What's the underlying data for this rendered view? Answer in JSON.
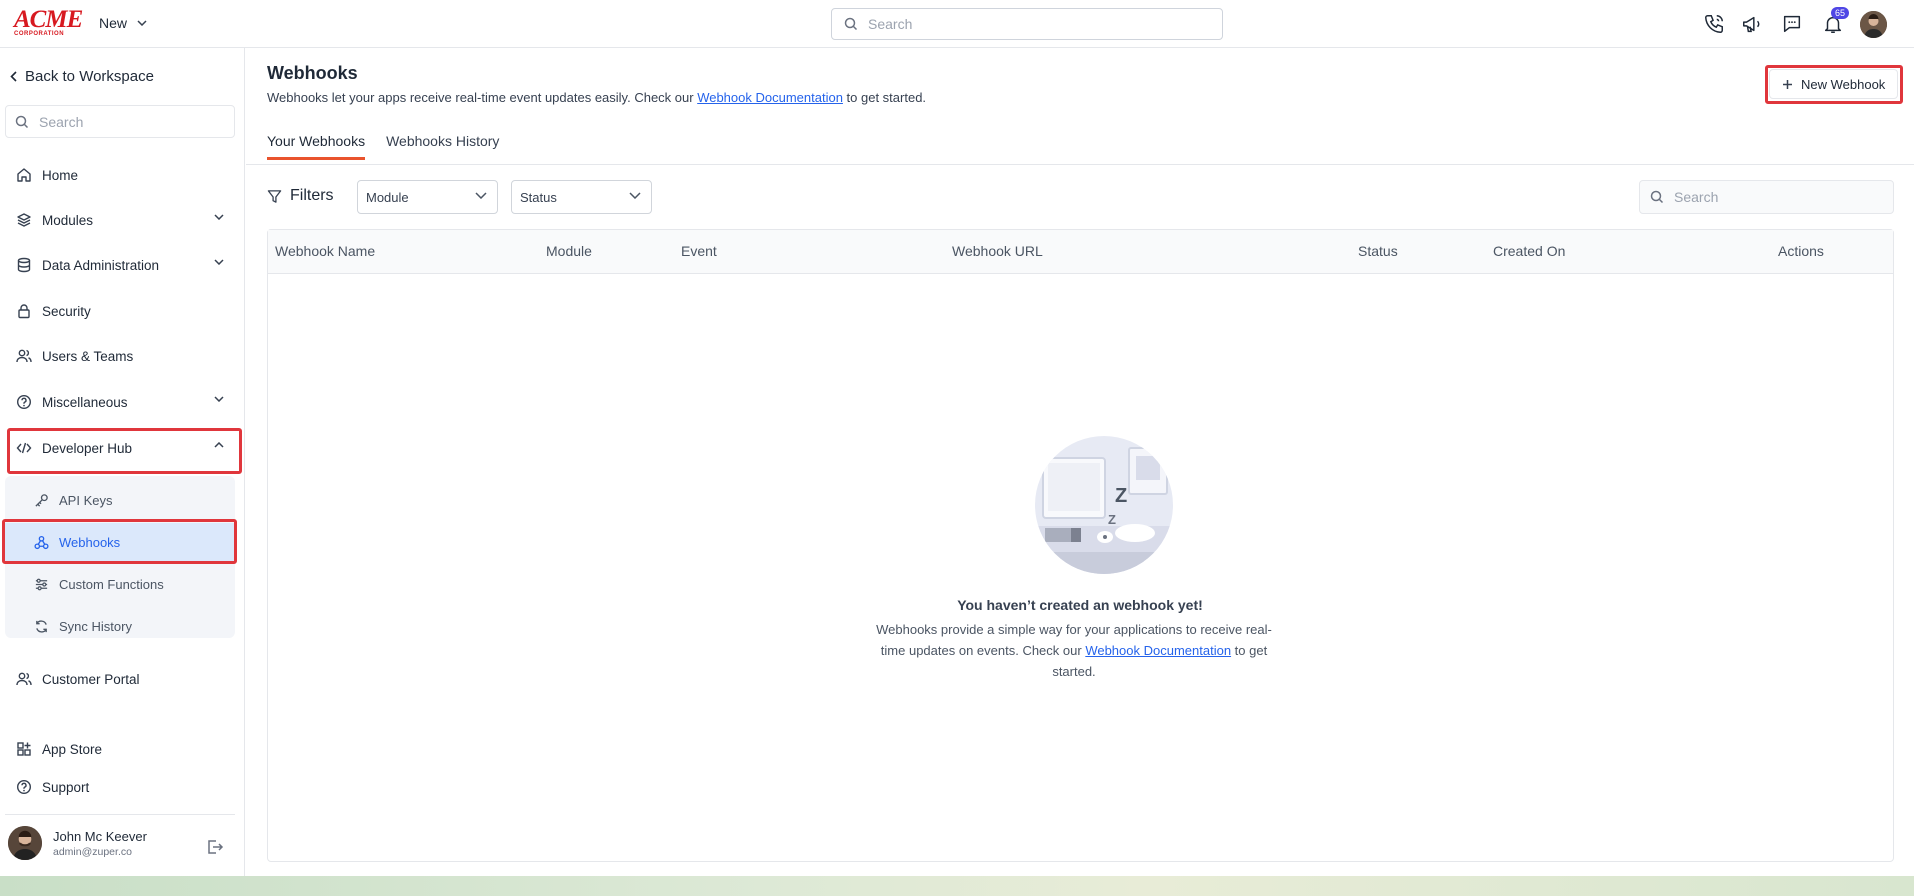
{
  "app": {
    "logo_word": "ACME",
    "logo_sub": "CORPORATION",
    "new_menu_label": "New",
    "search_placeholder": "Search",
    "notification_count": "65",
    "brand_color": "#d71920"
  },
  "sidebar": {
    "back_label": "Back to Workspace",
    "search_placeholder": "Search",
    "items": [
      {
        "label": "Home",
        "icon": "home-icon"
      },
      {
        "label": "Modules",
        "icon": "layers-icon",
        "expandable": true
      },
      {
        "label": "Data Administration",
        "icon": "database-icon",
        "expandable": true
      },
      {
        "label": "Security",
        "icon": "lock-icon"
      },
      {
        "label": "Users & Teams",
        "icon": "users-icon"
      },
      {
        "label": "Miscellaneous",
        "icon": "help-circle-icon",
        "expandable": true
      },
      {
        "label": "Developer Hub",
        "icon": "code-icon",
        "expanded": true
      }
    ],
    "developer_hub_items": [
      {
        "label": "API Keys",
        "icon": "key-icon"
      },
      {
        "label": "Webhooks",
        "icon": "webhook-icon",
        "active": true
      },
      {
        "label": "Custom Functions",
        "icon": "sliders-icon"
      },
      {
        "label": "Sync History",
        "icon": "sync-icon"
      }
    ],
    "bottom_items": [
      {
        "label": "Customer Portal",
        "icon": "users-icon"
      },
      {
        "label": "App Store",
        "icon": "apps-icon"
      },
      {
        "label": "Support",
        "icon": "help-circle-icon"
      }
    ],
    "user": {
      "name": "John Mc Keever",
      "email": "admin@zuper.co"
    }
  },
  "main": {
    "title": "Webhooks",
    "description_prefix": "Webhooks let your apps receive real-time event updates easily. Check our ",
    "description_link": "Webhook Documentation",
    "description_suffix": " to get started.",
    "new_button_label": "New Webhook",
    "tabs": [
      {
        "label": "Your Webhooks",
        "active": true
      },
      {
        "label": "Webhooks History",
        "active": false
      }
    ],
    "filters_label": "Filters",
    "filter_module": "Module",
    "filter_status": "Status",
    "table_search_placeholder": "Search",
    "columns": [
      "Webhook Name",
      "Module",
      "Event",
      "Webhook URL",
      "Status",
      "Created On",
      "Actions"
    ],
    "empty": {
      "title": "You haven’t created an webhook yet!",
      "text_prefix": "Webhooks provide a simple way for your applications to receive real-time updates on events. Check our ",
      "link": "Webhook Documentation",
      "text_suffix": " to get started."
    }
  },
  "highlight_color": "#e0363c",
  "accent_color": "#2563eb",
  "tab_accent_color": "#e9532d"
}
